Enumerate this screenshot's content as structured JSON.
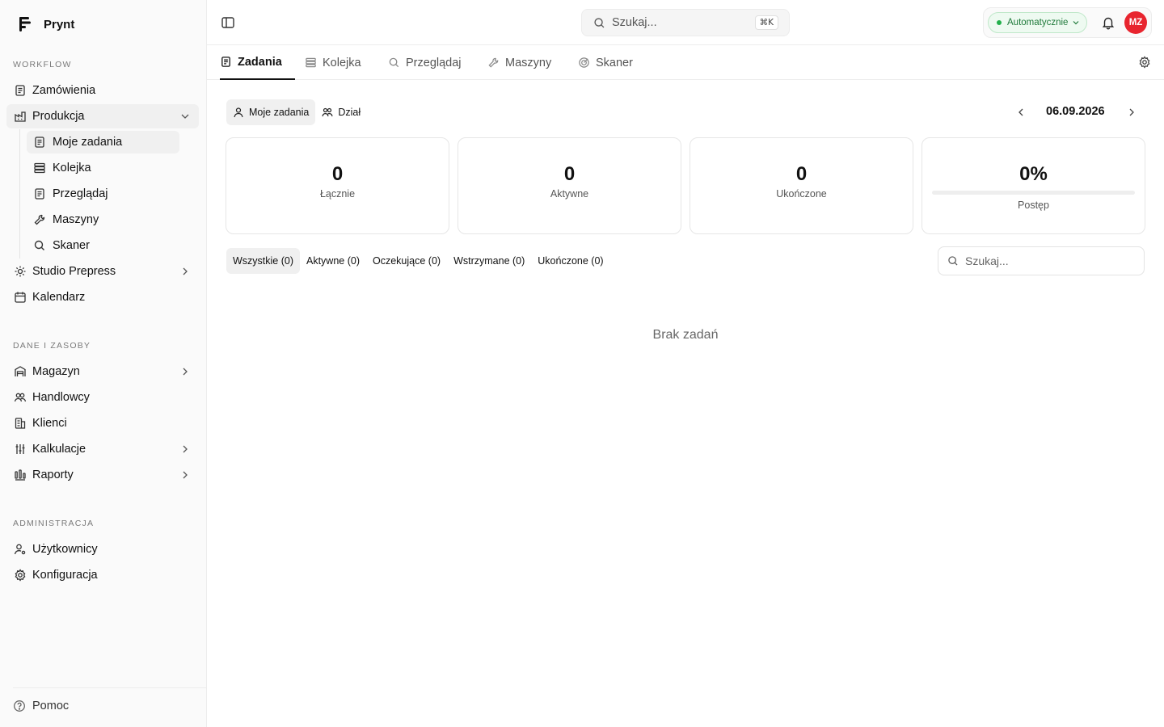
{
  "app": {
    "name": "Prynt"
  },
  "sidebar": {
    "sections": {
      "workflow": "WORKFLOW",
      "resources": "DANE I ZASOBY",
      "admin": "ADMINISTRACJA"
    },
    "items": {
      "orders": "Zamówienia",
      "production": "Produkcja",
      "studio": "Studio Prepress",
      "calendar": "Kalendarz",
      "warehouse": "Magazyn",
      "sales": "Handlowcy",
      "clients": "Klienci",
      "calculations": "Kalkulacje",
      "reports": "Raporty",
      "users": "Użytkownicy",
      "config": "Konfiguracja"
    },
    "production_sub": {
      "my_tasks": "Moje zadania",
      "queue": "Kolejka",
      "browse": "Przeglądaj",
      "machines": "Maszyny",
      "scanner": "Skaner"
    },
    "help": "Pomoc"
  },
  "topbar": {
    "search_placeholder": "Szukaj...",
    "shortcut": "⌘K",
    "mode": "Automatycznie",
    "mode_color": "#22b04b",
    "avatar_initials": "MZ",
    "avatar_color": "#e8252f"
  },
  "tabs": {
    "tasks": "Zadania",
    "queue": "Kolejka",
    "browse": "Przeglądaj",
    "machines": "Maszyny",
    "scanner": "Skaner"
  },
  "scope": {
    "mine": "Moje zadania",
    "department": "Dział"
  },
  "date": "06.09.2026",
  "stats": {
    "total": {
      "value": "0",
      "label": "Łącznie"
    },
    "active": {
      "value": "0",
      "label": "Aktywne"
    },
    "done": {
      "value": "0",
      "label": "Ukończone"
    },
    "progress": {
      "value": "0%",
      "label": "Postęp",
      "fraction": 0
    }
  },
  "filters": {
    "all": "Wszystkie (0)",
    "active": "Aktywne (0)",
    "pending": "Oczekujące (0)",
    "paused": "Wstrzymane (0)",
    "done": "Ukończone (0)"
  },
  "list_search_placeholder": "Szukaj...",
  "empty": "Brak zadań"
}
